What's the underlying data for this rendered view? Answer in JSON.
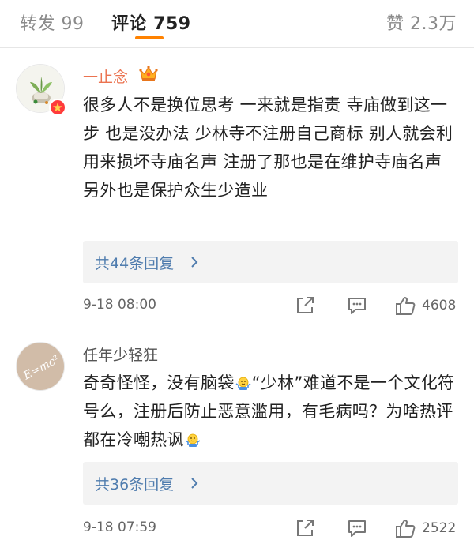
{
  "tabs": {
    "repost": "转发 99",
    "comment": "评论 759",
    "like": "赞 2.3万"
  },
  "colors": {
    "accent": "#ff8200",
    "username_vip": "#eb7350",
    "link": "#4f7cae"
  },
  "comments": [
    {
      "username": "一止念",
      "username_icon": "crown-icon",
      "avatar_icon": "plant-avatar",
      "text": "很多人不是换位思考 一来就是指责 寺庙做到这一步 也是没办法 少林寺不注册自己商标 别人就会利用来损坏寺庙名声 注册了那也是在维护寺庙名声 另外也是保护众生少造业",
      "replies_label": "共44条回复",
      "time": "9-18 08:00",
      "likes": "4608"
    },
    {
      "username": "任年少轻狂",
      "avatar_icon": "emc2-avatar",
      "text_parts": [
        "奇奇怪怪，没有脑袋",
        "“少林”难道不是一个文化符号么，注册后防止恶意滥用，有毛病吗？为啥热评都在冷嘲热讽"
      ],
      "emoji_icon": "shrug-emoji",
      "replies_label": "共36条回复",
      "time": "9-18 07:59",
      "likes": "2522"
    }
  ]
}
